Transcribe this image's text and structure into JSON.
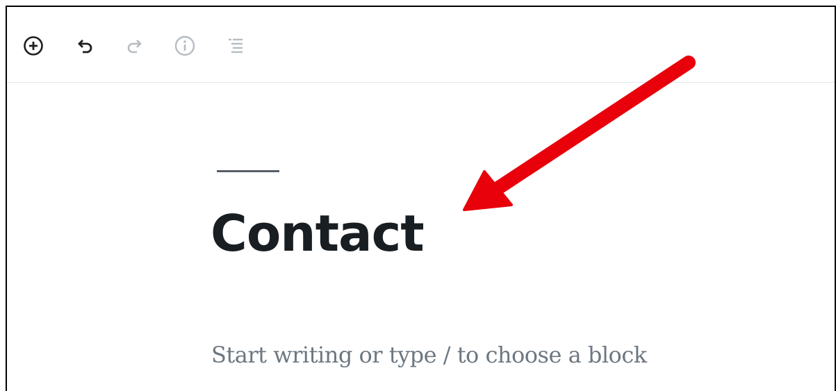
{
  "toolbar": {
    "buttons": [
      {
        "name": "add-block",
        "icon": "plus-circle-icon",
        "enabled": true
      },
      {
        "name": "undo",
        "icon": "undo-icon",
        "enabled": true
      },
      {
        "name": "redo",
        "icon": "redo-icon",
        "enabled": false
      },
      {
        "name": "info",
        "icon": "info-icon",
        "enabled": false
      },
      {
        "name": "outline",
        "icon": "list-outline-icon",
        "enabled": false
      }
    ]
  },
  "editor": {
    "title": "Contact",
    "placeholder": "Start writing or type / to choose a block"
  },
  "annotation": {
    "arrow_color": "#e8000b",
    "arrow_icon": "red-arrow-pointer"
  },
  "colors": {
    "enabled_icon": "#1e1e1e",
    "disabled_icon": "#b5bcc2",
    "title_text": "#191e23",
    "placeholder_text": "#6c7781"
  }
}
